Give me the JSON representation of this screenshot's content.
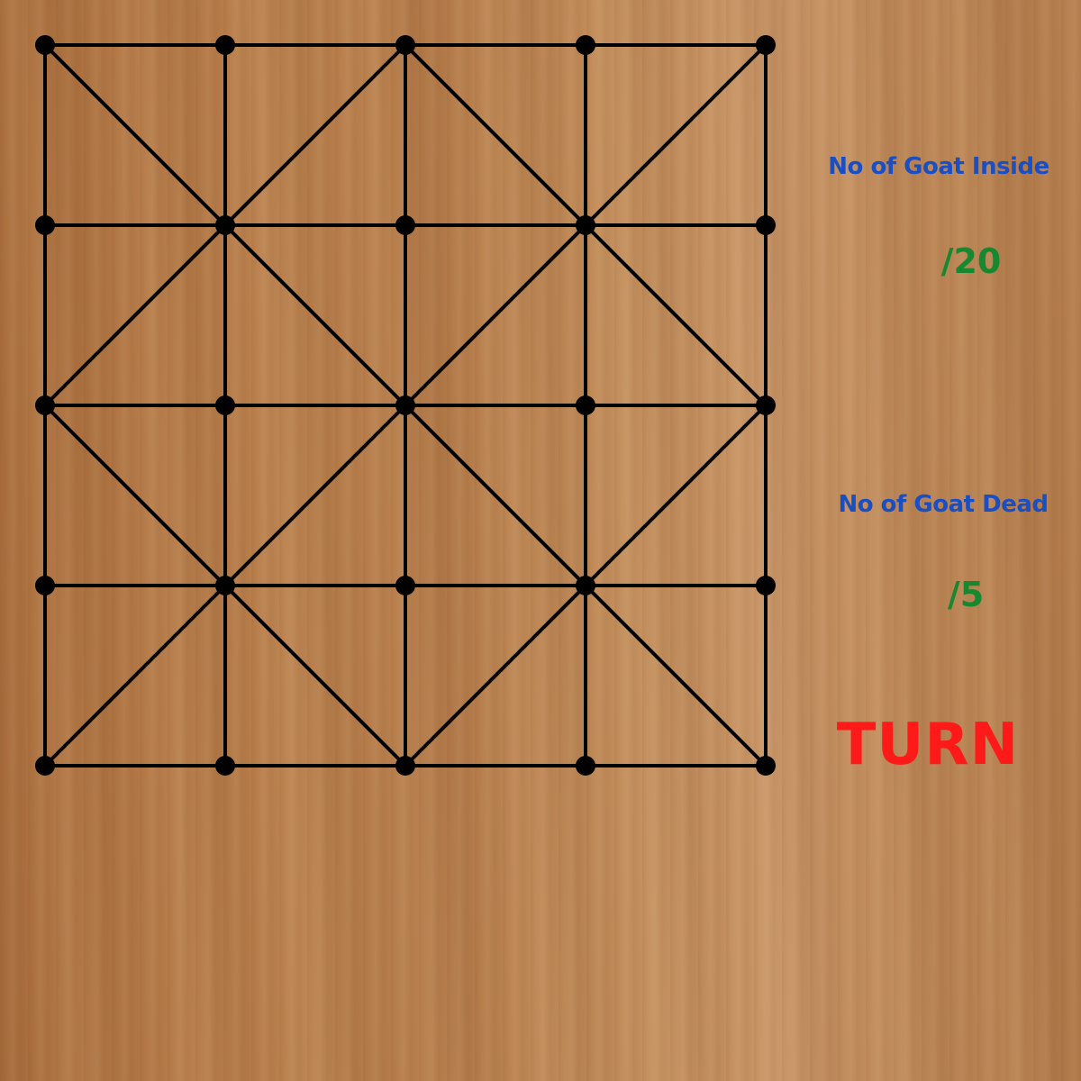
{
  "board": {
    "grid_size": 5,
    "line_color": "#000000",
    "point_color": "#000000"
  },
  "status_panel": {
    "goat_inside_label": "No of Goat Inside",
    "goat_inside_count": "/20",
    "goat_dead_label": "No of Goat Dead",
    "goat_dead_count": "/5",
    "turn_label": "TURN"
  },
  "colors": {
    "label_color": "#1a4fc4",
    "count_color": "#17882f",
    "turn_color": "#ff1a1a"
  }
}
